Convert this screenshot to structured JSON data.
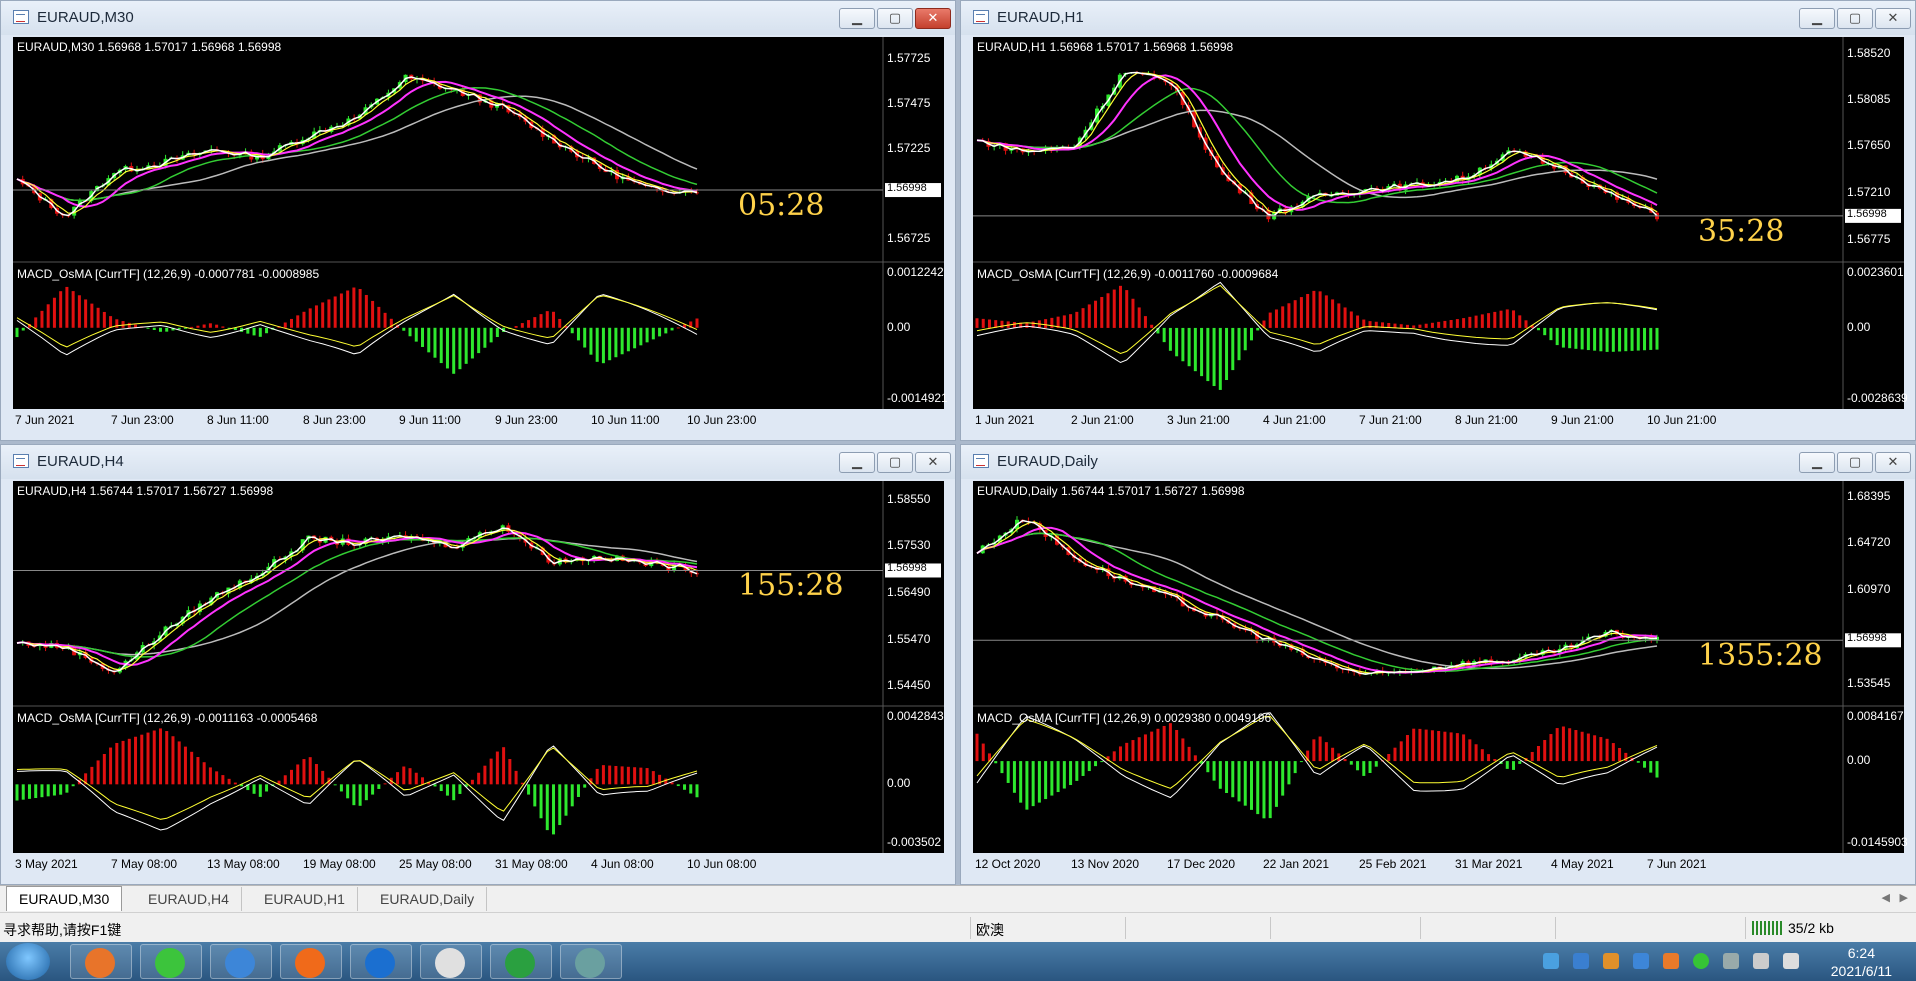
{
  "colors": {
    "bull": "#2ee82e",
    "bear": "#e01010",
    "ma_white": "#ffffff",
    "ma_yellow": "#ffff33",
    "ma_magenta": "#ff33ff",
    "ma_green": "#33cc33",
    "ma_gray": "#bbbbbb",
    "countdown": "#ffd24a"
  },
  "windows": [
    {
      "title": "EURAUD,M30",
      "info": "EURAUD,M30  1.56968 1.57017 1.56968 1.56998",
      "price_ticks": [
        "1.57725",
        "1.57475",
        "1.57225",
        "1.56998",
        "1.56725"
      ],
      "current_price": "1.56998",
      "countdown": "05:28",
      "macd_label": "MACD_OsMA [CurrTF] (12,26,9) -0.0007781 -0.0008985",
      "macd_ticks": [
        "0.0012242",
        "0.00",
        "-0.0014921"
      ],
      "time_labels": [
        "7 Jun 2021",
        "7 Jun 23:00",
        "8 Jun 11:00",
        "8 Jun 23:00",
        "9 Jun 11:00",
        "9 Jun 23:00",
        "10 Jun 11:00",
        "10 Jun 23:00"
      ],
      "close_style": "red",
      "chart_data": {
        "type": "line",
        "name": "price",
        "x_labels": [
          "7 Jun 2021",
          "7 Jun 23:00",
          "8 Jun 11:00",
          "8 Jun 23:00",
          "9 Jun 11:00",
          "9 Jun 23:00",
          "10 Jun 11:00",
          "10 Jun 23:00"
        ],
        "closes": [
          1.5705,
          1.5685,
          1.571,
          1.5715,
          1.5722,
          1.5718,
          1.573,
          1.574,
          1.5762,
          1.5755,
          1.5745,
          1.5728,
          1.5712,
          1.57,
          1.56998
        ],
        "ylim": [
          1.5665,
          1.578
        ],
        "macd_values": [
          -0.0002,
          0.0009,
          0.0002,
          -0.0001,
          0.0001,
          -0.0002,
          0.0004,
          0.0009,
          -0.0001,
          -0.001,
          -0.0001,
          0.0004,
          -0.0008,
          -0.0003,
          0.0002
        ],
        "macd_ylim": [
          -0.0014921,
          0.0012242
        ]
      }
    },
    {
      "title": "EURAUD,H1",
      "info": "EURAUD,H1  1.56968 1.57017 1.56968 1.56998",
      "price_ticks": [
        "1.58520",
        "1.58085",
        "1.57650",
        "1.57210",
        "1.56998",
        "1.56775"
      ],
      "current_price": "1.56998",
      "countdown": "35:28",
      "macd_label": "MACD_OsMA [CurrTF] (12,26,9) -0.0011760 -0.0009684",
      "macd_ticks": [
        "0.0023601",
        "0.00",
        "-0.0028639"
      ],
      "time_labels": [
        "1 Jun 2021",
        "2 Jun 21:00",
        "3 Jun 21:00",
        "4 Jun 21:00",
        "7 Jun 21:00",
        "8 Jun 21:00",
        "9 Jun 21:00",
        "10 Jun 21:00"
      ],
      "close_style": "plain",
      "chart_data": {
        "type": "line",
        "name": "price",
        "x_labels": [
          "1 Jun 2021",
          "2 Jun 21:00",
          "3 Jun 21:00",
          "4 Jun 21:00",
          "7 Jun 21:00",
          "8 Jun 21:00",
          "9 Jun 21:00",
          "10 Jun 21:00"
        ],
        "closes": [
          1.577,
          1.576,
          1.5765,
          1.5835,
          1.5825,
          1.574,
          1.57,
          1.5718,
          1.5725,
          1.5728,
          1.5735,
          1.576,
          1.5745,
          1.572,
          1.56998
        ],
        "ylim": [
          1.5665,
          1.586
        ],
        "macd_values": [
          0.0004,
          0.0002,
          0.0006,
          0.0018,
          -0.001,
          -0.0026,
          0.0006,
          0.0016,
          0.0003,
          0.0001,
          0.0004,
          0.0008,
          -0.0008,
          -0.001,
          -0.0009
        ],
        "macd_ylim": [
          -0.0028639,
          0.0023601
        ]
      }
    },
    {
      "title": "EURAUD,H4",
      "info": "EURAUD,H4  1.56744 1.57017 1.56727 1.56998",
      "price_ticks": [
        "1.58550",
        "1.57530",
        "1.56998",
        "1.56490",
        "1.55470",
        "1.54450"
      ],
      "current_price": "1.56998",
      "countdown": "155:28",
      "macd_label": "MACD_OsMA [CurrTF] (12,26,9) -0.0011163 -0.0005468",
      "macd_ticks": [
        "0.0042843",
        "0.00",
        "-0.003502"
      ],
      "time_labels": [
        "3 May 2021",
        "7 May 08:00",
        "13 May 08:00",
        "19 May 08:00",
        "25 May 08:00",
        "31 May 08:00",
        "4 Jun 08:00",
        "10 Jun 08:00"
      ],
      "close_style": "plain",
      "chart_data": {
        "type": "line",
        "name": "price",
        "x_labels": [
          "3 May 2021",
          "7 May 08:00",
          "13 May 08:00",
          "19 May 08:00",
          "25 May 08:00",
          "31 May 08:00",
          "4 Jun 08:00",
          "10 Jun 08:00"
        ],
        "closes": [
          1.554,
          1.553,
          1.5475,
          1.5565,
          1.564,
          1.5695,
          1.577,
          1.576,
          1.5775,
          1.5755,
          1.58,
          1.572,
          1.573,
          1.5715,
          1.56998
        ],
        "ylim": [
          1.542,
          1.588
        ],
        "macd_values": [
          -0.001,
          -0.0006,
          0.0025,
          0.0035,
          0.001,
          -0.0008,
          0.0018,
          -0.0015,
          0.0012,
          -0.001,
          0.0024,
          -0.0033,
          0.0012,
          0.001,
          -0.0008
        ],
        "macd_ylim": [
          -0.003502,
          0.0042843
        ]
      }
    },
    {
      "title": "EURAUD,Daily",
      "info": "EURAUD,Daily  1.56744 1.57017 1.56727 1.56998",
      "price_ticks": [
        "1.68395",
        "1.64720",
        "1.60970",
        "1.56998",
        "1.53545"
      ],
      "current_price": "1.56998",
      "countdown": "1355:28",
      "macd_label": "MACD_OsMA [CurrTF] (12,26,9) 0.0029380 0.0049196",
      "macd_ticks": [
        "0.0084167",
        "0.00",
        "-0.0145903"
      ],
      "time_labels": [
        "12 Oct 2020",
        "13 Nov 2020",
        "17 Dec 2020",
        "22 Jan 2021",
        "25 Feb 2021",
        "31 Mar 2021",
        "4 May 2021",
        "7 Jun 2021"
      ],
      "close_style": "plain",
      "chart_data": {
        "type": "line",
        "name": "price",
        "x_labels": [
          "12 Oct 2020",
          "13 Nov 2020",
          "17 Dec 2020",
          "22 Jan 2021",
          "25 Feb 2021",
          "31 Mar 2021",
          "4 May 2021",
          "7 Jun 2021"
        ],
        "closes": [
          1.64,
          1.668,
          1.635,
          1.618,
          1.603,
          1.586,
          1.57,
          1.554,
          1.542,
          1.546,
          1.552,
          1.554,
          1.562,
          1.576,
          1.56998
        ],
        "ylim": [
          1.525,
          1.69
        ],
        "macd_values": [
          0.005,
          -0.009,
          -0.004,
          0.003,
          0.007,
          -0.005,
          -0.011,
          0.005,
          -0.003,
          0.006,
          0.005,
          -0.002,
          0.0065,
          0.004,
          -0.003
        ],
        "macd_ylim": [
          -0.0145903,
          0.0084167
        ]
      }
    }
  ],
  "tabs": [
    "EURAUD,M30",
    "EURAUD,H4",
    "EURAUD,H1",
    "EURAUD,Daily"
  ],
  "active_tab": 0,
  "status": {
    "help": "寻求帮助,请按F1键",
    "profile": "欧澳",
    "traffic": "35/2 kb"
  },
  "taskbar": {
    "time": "6:24",
    "date": "2021/6/11",
    "apps": [
      "start-orb-icon",
      "app-orange-icon",
      "wechat-icon",
      "pen-icon",
      "firefox-icon",
      "app-blue-icon",
      "app-chart-icon",
      "app-green-icon",
      "mt4-icon"
    ]
  }
}
